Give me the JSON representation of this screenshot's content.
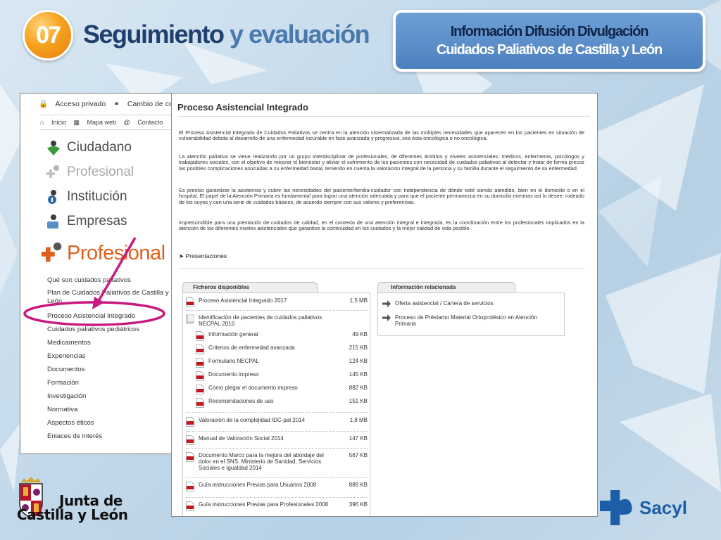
{
  "header": {
    "badge_number": "07",
    "title_strong": "Seguimiento",
    "title_light": "y evaluación",
    "info_line1": "Información Difusión Divulgación",
    "info_line2": "Cuidados Paliativos de Castilla y León"
  },
  "left_panel": {
    "top_links": [
      "Acceso privado",
      "Cambio de cor"
    ],
    "nav_links": [
      "Inicio",
      "Mapa web",
      "Contacto"
    ],
    "profiles": [
      {
        "label": "Ciudadano",
        "icon": "citizen-icon",
        "faded": false
      },
      {
        "label": "Profesional",
        "icon": "professional-icon",
        "faded": true
      },
      {
        "label": "Institución",
        "icon": "institution-icon",
        "faded": false
      },
      {
        "label": "Empresas",
        "icon": "business-icon",
        "faded": false
      }
    ],
    "active_profile": "Profesional",
    "menu": [
      "Qué son cuidados paliativos",
      "Plan de Cuidados Paliativos de Castilla y León",
      "Proceso Asistencial Integrado",
      "Cuidados paliativos pediátricos",
      "Medicamentos",
      "Experiencias",
      "Documentos",
      "Formación",
      "Investigación",
      "Normativa",
      "Aspectos éticos",
      "Enlaces de interés"
    ]
  },
  "right_panel": {
    "title": "Proceso Asistencial Integrado",
    "paragraphs": [
      "El Proceso Asistencial Integrado de Cuidados Paliativos se centra en la atención sistematizada de las múltiples necesidades que aparecen en los pacientes en situación de vulnerabilidad debida al desarrollo de una enfermedad incurable en fase avanzada y progresiva, sea ésta oncológica o no oncológica.",
      "La atención paliativa se viene realizando por un grupo interdisciplinar de profesionales, de diferentes ámbitos y niveles asistenciales: médicos, enfermeras, psicólogos y trabajadores sociales, con el objetivo de mejorar el bienestar y aliviar el sufrimiento de los pacientes con necesidad de cuidados paliativos al detectar y tratar de forma precoz las posibles complicaciones asociadas a su enfermedad basal, teniendo en cuenta la valoración integral de la persona y su familia durante el seguimiento de su enfermedad.",
      "Es preciso garantizar la asistencia y cubrir las necesidades del paciente/familia-cuidador con independencia de dónde esté siendo atendido, bien en el domicilio o en el hospital. El papel de la Atención Primaria es fundamental para lograr una atención adecuada y para que el paciente permanezca en su domicilio mientras así lo desee, rodeado de los suyos y con una serie de cuidados básicos, de acuerdo siempre con sus valores y preferencias.",
      "Imprescindible para una prestación de cuidados de calidad, en el contexto de una atención integral e integrada, es la coordinación entre los profesionales implicados en la atención de los diferentes niveles asistenciales que garantice la continuidad en los cuidados y la mejor calidad de vida posible."
    ],
    "presentations_link": "Presentaciones",
    "files_tab": "Ficheros disponibles",
    "files": [
      {
        "name": "Proceso Asistencial Integrado 2017",
        "size": "1,5 MB",
        "indent": false,
        "icon": "pdf-icon"
      },
      {
        "name": "Identificación de pacientes de cuidados paliativos NECPAL 2016",
        "size": "",
        "indent": false,
        "icon": "folder-icon"
      },
      {
        "name": "Información general",
        "size": "49 KB",
        "indent": true,
        "icon": "pdf-icon"
      },
      {
        "name": "Criterios de enfermedad avanzada",
        "size": "215 KB",
        "indent": true,
        "icon": "pdf-icon"
      },
      {
        "name": "Formulario NECPAL",
        "size": "124 KB",
        "indent": true,
        "icon": "pdf-icon"
      },
      {
        "name": "Documento impreso",
        "size": "145 KB",
        "indent": true,
        "icon": "pdf-icon"
      },
      {
        "name": "Cómo plegar el documento impreso",
        "size": "882 KB",
        "indent": true,
        "icon": "pdf-icon"
      },
      {
        "name": "Recomendaciones de uso",
        "size": "151 KB",
        "indent": true,
        "icon": "pdf-icon"
      },
      {
        "name": "Valoración de la complejidad IDC-pal 2014",
        "size": "1,8 MB",
        "indent": false,
        "icon": "pdf-icon"
      },
      {
        "name": "Manual de Valoración Social 2014",
        "size": "147 KB",
        "indent": false,
        "icon": "pdf-icon"
      },
      {
        "name": "Documento Marco para la mejora del abordaje del dolor en el SNS. Ministerio de Sanidad, Servicios Sociales e Igualdad 2014",
        "size": "567 KB",
        "indent": false,
        "icon": "pdf-icon"
      },
      {
        "name": "Guía instrucciones Previas para Usuarios 2008",
        "size": "889 KB",
        "indent": false,
        "icon": "pdf-icon"
      },
      {
        "name": "Guía instrucciones Previas para Profesionales 2008",
        "size": "396 KB",
        "indent": false,
        "icon": "pdf-icon"
      }
    ],
    "info_tab": "Información relacionada",
    "related": [
      {
        "label": "Oferta asistencial / Cartera de servicios",
        "icon": "arrow-right-icon"
      },
      {
        "label": "Proceso de Préstamo Material Ortoprotésico en Atención Primaria",
        "icon": "arrow-right-icon"
      }
    ]
  },
  "footer": {
    "junta_line1": "Junta de",
    "junta_line2": "Castilla y León",
    "sacyl": "Sacyl"
  },
  "colors": {
    "title_dark": "#1f3f70",
    "title_light": "#4a79ad",
    "badge": "#f6a21e",
    "profesional_orange": "#e0601b",
    "annotation": "#c8197e",
    "sacyl_blue": "#1d5ea8"
  }
}
